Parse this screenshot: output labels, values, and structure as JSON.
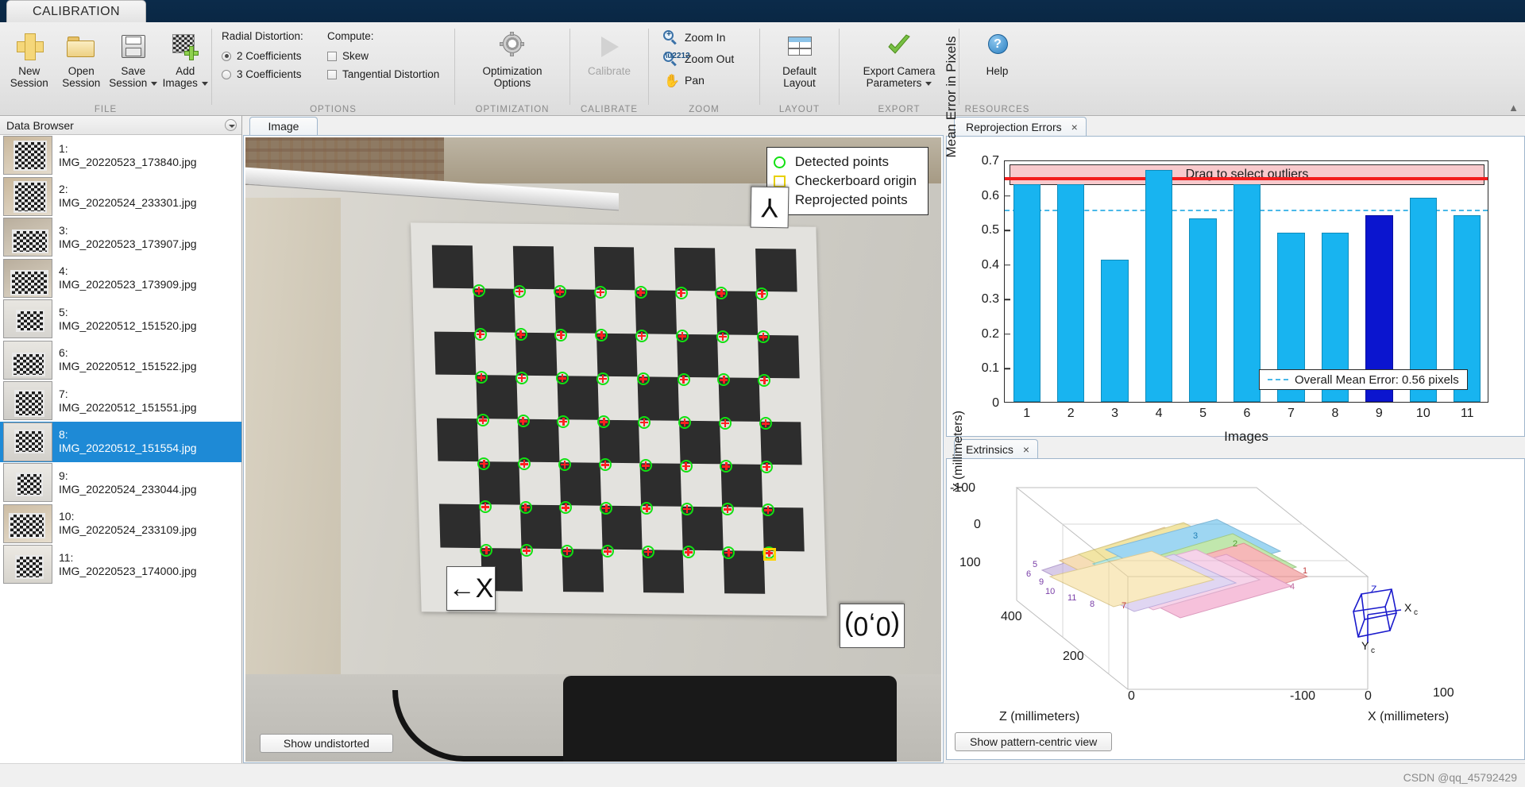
{
  "window": {
    "tab_label": "CALIBRATION"
  },
  "ribbon": {
    "groups": [
      {
        "name": "FILE"
      },
      {
        "name": "OPTIONS"
      },
      {
        "name": "OPTIMIZATION"
      },
      {
        "name": "CALIBRATE"
      },
      {
        "name": "ZOOM"
      },
      {
        "name": "LAYOUT"
      },
      {
        "name": "EXPORT"
      },
      {
        "name": "RESOURCES"
      }
    ],
    "file": {
      "new_session": "New\nSession",
      "new_session_l1": "New",
      "new_session_l2": "Session",
      "open_session_l1": "Open",
      "open_session_l2": "Session",
      "save_session_l1": "Save",
      "save_session_l2": "Session",
      "add_images_l1": "Add",
      "add_images_l2": "Images"
    },
    "options": {
      "radial_label": "Radial Distortion:",
      "compute_label": "Compute:",
      "coef2": "2 Coefficients",
      "coef3": "3 Coefficients",
      "skew": "Skew",
      "tangential": "Tangential Distortion",
      "coef2_selected": true,
      "coef3_selected": false,
      "skew_checked": false,
      "tangential_checked": false
    },
    "optimization": {
      "l1": "Optimization",
      "l2": "Options"
    },
    "calibrate": {
      "label": "Calibrate",
      "disabled": true
    },
    "zoom": {
      "zoom_in": "Zoom In",
      "zoom_out": "Zoom Out",
      "pan": "Pan"
    },
    "layout": {
      "l1": "Default",
      "l2": "Layout"
    },
    "export": {
      "l1": "Export Camera",
      "l2": "Parameters"
    },
    "resources": {
      "help": "Help"
    }
  },
  "data_browser": {
    "title": "Data Browser",
    "items": [
      {
        "index": "1:",
        "filename": "IMG_20220523_173840.jpg",
        "selected": false
      },
      {
        "index": "2:",
        "filename": "IMG_20220524_233301.jpg",
        "selected": false
      },
      {
        "index": "3:",
        "filename": "IMG_20220523_173907.jpg",
        "selected": false
      },
      {
        "index": "4:",
        "filename": "IMG_20220523_173909.jpg",
        "selected": false
      },
      {
        "index": "5:",
        "filename": "IMG_20220512_151520.jpg",
        "selected": false
      },
      {
        "index": "6:",
        "filename": "IMG_20220512_151522.jpg",
        "selected": false
      },
      {
        "index": "7:",
        "filename": "IMG_20220512_151551.jpg",
        "selected": false
      },
      {
        "index": "8:",
        "filename": "IMG_20220512_151554.jpg",
        "selected": true
      },
      {
        "index": "9:",
        "filename": "IMG_20220524_233044.jpg",
        "selected": false
      },
      {
        "index": "10:",
        "filename": "IMG_20220524_233109.jpg",
        "selected": false
      },
      {
        "index": "11:",
        "filename": "IMG_20220523_174000.jpg",
        "selected": false
      }
    ]
  },
  "image_panel": {
    "tab_label": "Image",
    "legend": [
      {
        "marker": "circle",
        "label": "Detected points"
      },
      {
        "marker": "square",
        "label": "Checkerboard origin"
      },
      {
        "marker": "plus",
        "label": "Reprojected points"
      }
    ],
    "annotations": {
      "y_axis": "Y",
      "x_axis": "←X",
      "origin": "(0,0)"
    },
    "undistort_button": "Show undistorted"
  },
  "reprojection_panel": {
    "tab_label": "Reprojection Errors",
    "close": "×",
    "outlier_banner": "Drag to select outliers",
    "mean_note": "Overall Mean Error: 0.56 pixels"
  },
  "extrinsics_panel": {
    "tab_label": "Extrinsics",
    "close": "×",
    "pattern_button": "Show pattern-centric view",
    "axis_labels": {
      "x": "X (millimeters)",
      "y": "Y (millimeters)",
      "z": "Z (millimeters)"
    },
    "x_ticks": [
      "100",
      "0",
      "-100"
    ],
    "y_ticks": [
      "-100",
      "0",
      "100"
    ],
    "z_ticks": [
      "400",
      "200",
      "0"
    ],
    "camera_axes": [
      "X",
      "Y",
      "Z"
    ],
    "board_numbers": [
      "1",
      "2",
      "3",
      "4",
      "5",
      "6",
      "7",
      "8",
      "9",
      "10",
      "11"
    ]
  },
  "watermark": "CSDN @qq_45792429",
  "colors": {
    "accent": "#1e8ad6",
    "bar": "#18b4f0",
    "bar_selected": "#0b15cf",
    "outlier_line": "#f21c1c",
    "outlier_band": "#f8c9cc",
    "mean_line": "#49b8e8",
    "detected": "#12e012",
    "reprojected": "#ff2020",
    "origin": "#ffd400"
  },
  "chart_data": {
    "type": "bar",
    "title": "Reprojection Errors",
    "xlabel": "Images",
    "ylabel": "Mean Error in Pixels",
    "categories": [
      "1",
      "2",
      "3",
      "4",
      "5",
      "6",
      "7",
      "8",
      "9",
      "10",
      "11"
    ],
    "values": [
      0.63,
      0.63,
      0.41,
      0.67,
      0.53,
      0.63,
      0.49,
      0.49,
      0.54,
      0.59,
      0.54
    ],
    "selected_index": 8,
    "ylim": [
      0,
      0.7
    ],
    "yticks": [
      0,
      0.1,
      0.2,
      0.3,
      0.4,
      0.5,
      0.6,
      0.7
    ],
    "mean_error": 0.56,
    "mean_line_label": "Overall Mean Error: 0.56 pixels",
    "outlier_threshold": 0.655,
    "grid": false,
    "legend": "none"
  }
}
